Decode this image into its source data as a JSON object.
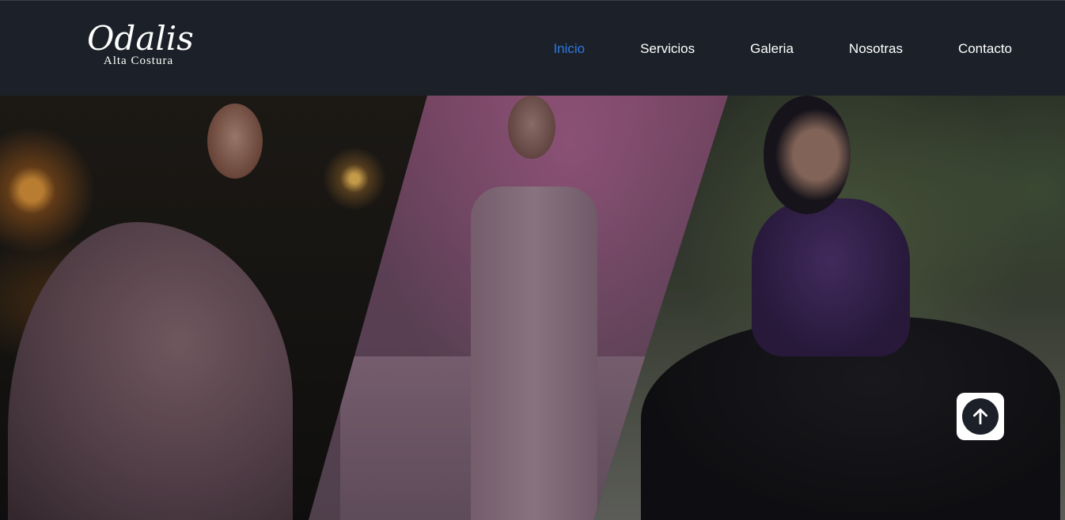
{
  "brand": {
    "name": "Odalis",
    "tagline": "Alta Costura"
  },
  "nav": {
    "items": [
      {
        "label": "Inicio",
        "active": true
      },
      {
        "label": "Servicios",
        "active": false
      },
      {
        "label": "Galeria",
        "active": false
      },
      {
        "label": "Nosotras",
        "active": false
      },
      {
        "label": "Contacto",
        "active": false
      }
    ]
  },
  "hero": {
    "panels": [
      "pink-sequin-gown-photo",
      "blush-satin-gown-photo",
      "purple-black-dress-photo"
    ]
  },
  "back_to_top": {
    "icon": "arrow-up-icon"
  },
  "colors": {
    "header_bg": "#1c2129",
    "nav_active": "#2a78e4",
    "nav_text": "#ffffff"
  }
}
